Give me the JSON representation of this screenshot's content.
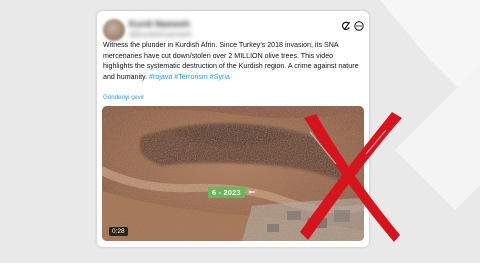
{
  "tweet": {
    "author_name": "Kurdi Nameeh",
    "author_handle": "@kurdishnameeh",
    "text": "Witness the plunder in Kurdish Afrin. Since Turkey's 2018 invasion, its SNA mercenaries have cut down/stolen over 2 MILLION olive trees. This video highlights the systematic destruction of the Kurdish region. A crime against nature and humanity.",
    "hashtags": [
      "#rojava",
      "#Terrorism",
      "#Syria"
    ],
    "translate_label": "Gönderiyi çevir",
    "header_icons": [
      "grok-icon",
      "more-icon"
    ]
  },
  "media": {
    "overlay_label": "6 - 2023",
    "arrow_glyph": "⇐",
    "duration": "0:28"
  },
  "overlay": {
    "verdict_icon": "red-x-icon",
    "verdict_color": "#d7141d"
  }
}
